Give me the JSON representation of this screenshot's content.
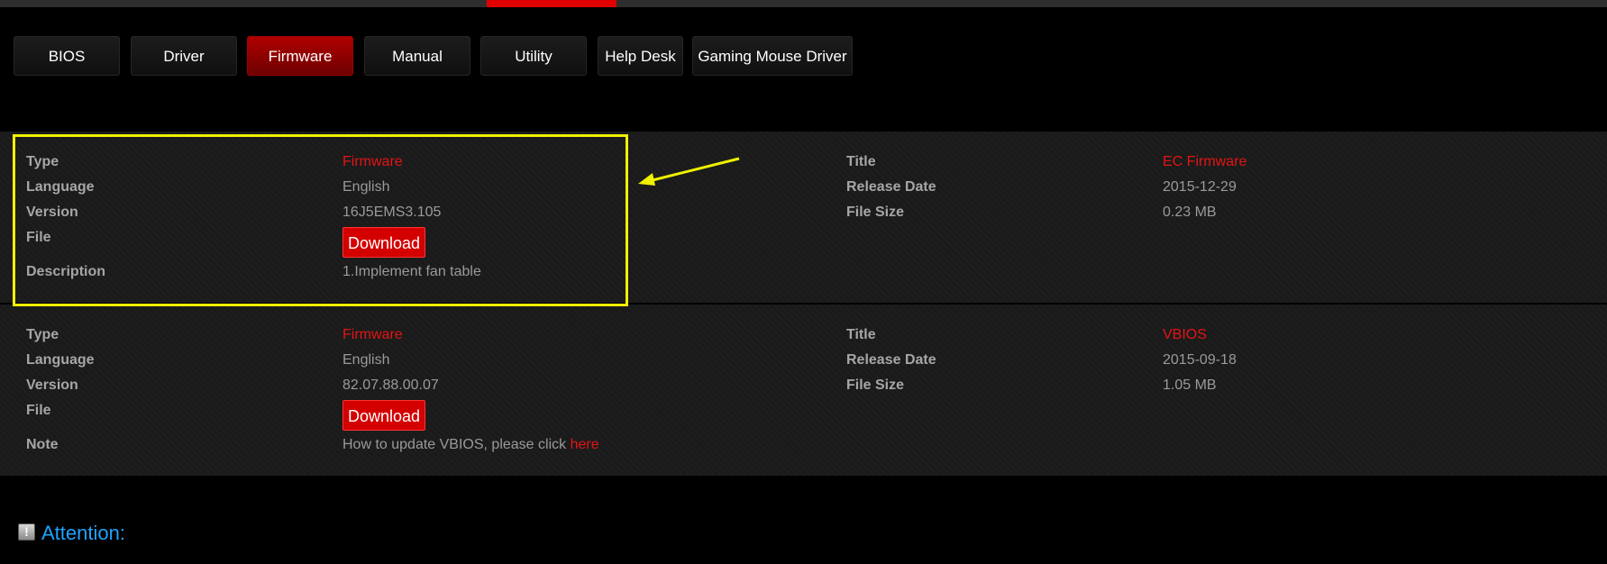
{
  "tabs": [
    {
      "label": "BIOS",
      "active": false
    },
    {
      "label": "Driver",
      "active": false
    },
    {
      "label": "Firmware",
      "active": true
    },
    {
      "label": "Manual",
      "active": false
    },
    {
      "label": "Utility",
      "active": false
    },
    {
      "label": "Help Desk",
      "active": false
    },
    {
      "label": "Gaming Mouse Driver",
      "active": false
    }
  ],
  "items": [
    {
      "type_label": "Type",
      "type_value": "Firmware",
      "language_label": "Language",
      "language_value": "English",
      "version_label": "Version",
      "version_value": "16J5EMS3.105",
      "file_label": "File",
      "download_label": "Download",
      "extra_label": "Description",
      "extra_value": "1.Implement fan table",
      "title_label": "Title",
      "title_value": "EC Firmware",
      "release_label": "Release Date",
      "release_value": "2015-12-29",
      "size_label": "File Size",
      "size_value": "0.23 MB"
    },
    {
      "type_label": "Type",
      "type_value": "Firmware",
      "language_label": "Language",
      "language_value": "English",
      "version_label": "Version",
      "version_value": "82.07.88.00.07",
      "file_label": "File",
      "download_label": "Download",
      "extra_label": "Note",
      "extra_value": "How to update VBIOS, please click ",
      "extra_link": "here",
      "title_label": "Title",
      "title_value": "VBIOS",
      "release_label": "Release Date",
      "release_value": "2015-09-18",
      "size_label": "File Size",
      "size_value": "1.05 MB"
    }
  ],
  "attention": {
    "icon": "exclamation-icon",
    "icon_glyph": "!",
    "text": "Attention:"
  },
  "colors": {
    "accent_red": "#e41414",
    "highlight_yellow": "#f0f000",
    "attention_blue": "#1fa3ff"
  }
}
